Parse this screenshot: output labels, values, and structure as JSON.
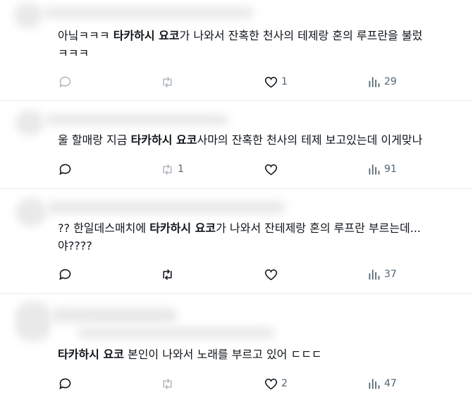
{
  "tweets": [
    {
      "parts": [
        "아닠ㅋㅋㅋ ",
        "타카하시 요코",
        "가 나와서 잔혹한 천사의 테제랑 혼의 루프란을 불렀",
        "ㅋㅋㅋ"
      ],
      "replies": "",
      "retweets": "",
      "likes": "1",
      "views": "29"
    },
    {
      "parts": [
        "울 할매랑 지금 ",
        "타카하시 요코",
        "사마의 잔혹한 천사의 테제 보고있는데 이게맞나"
      ],
      "replies": "",
      "retweets": "1",
      "likes": "",
      "views": "91"
    },
    {
      "parts": [
        "?? 한일데스매치에 ",
        "타카하시 요코",
        "가 나와서 잔테제랑 혼의 루프란 부르는데... ",
        "야????"
      ],
      "replies": "",
      "retweets": "",
      "likes": "",
      "views": "37"
    },
    {
      "parts": [
        "타카하시 요코",
        " 본인이 나와서 노래를 부르고 있어 ㄷㄷㄷ"
      ],
      "replies": "",
      "retweets": "",
      "likes": "2",
      "views": "47"
    }
  ],
  "icons": {
    "reply": "reply-icon",
    "retweet": "retweet-icon",
    "like": "heart-icon",
    "views": "views-icon"
  },
  "colors": {
    "text": "#0f1419",
    "muted": "#536471",
    "divider": "#e6ecf0"
  }
}
